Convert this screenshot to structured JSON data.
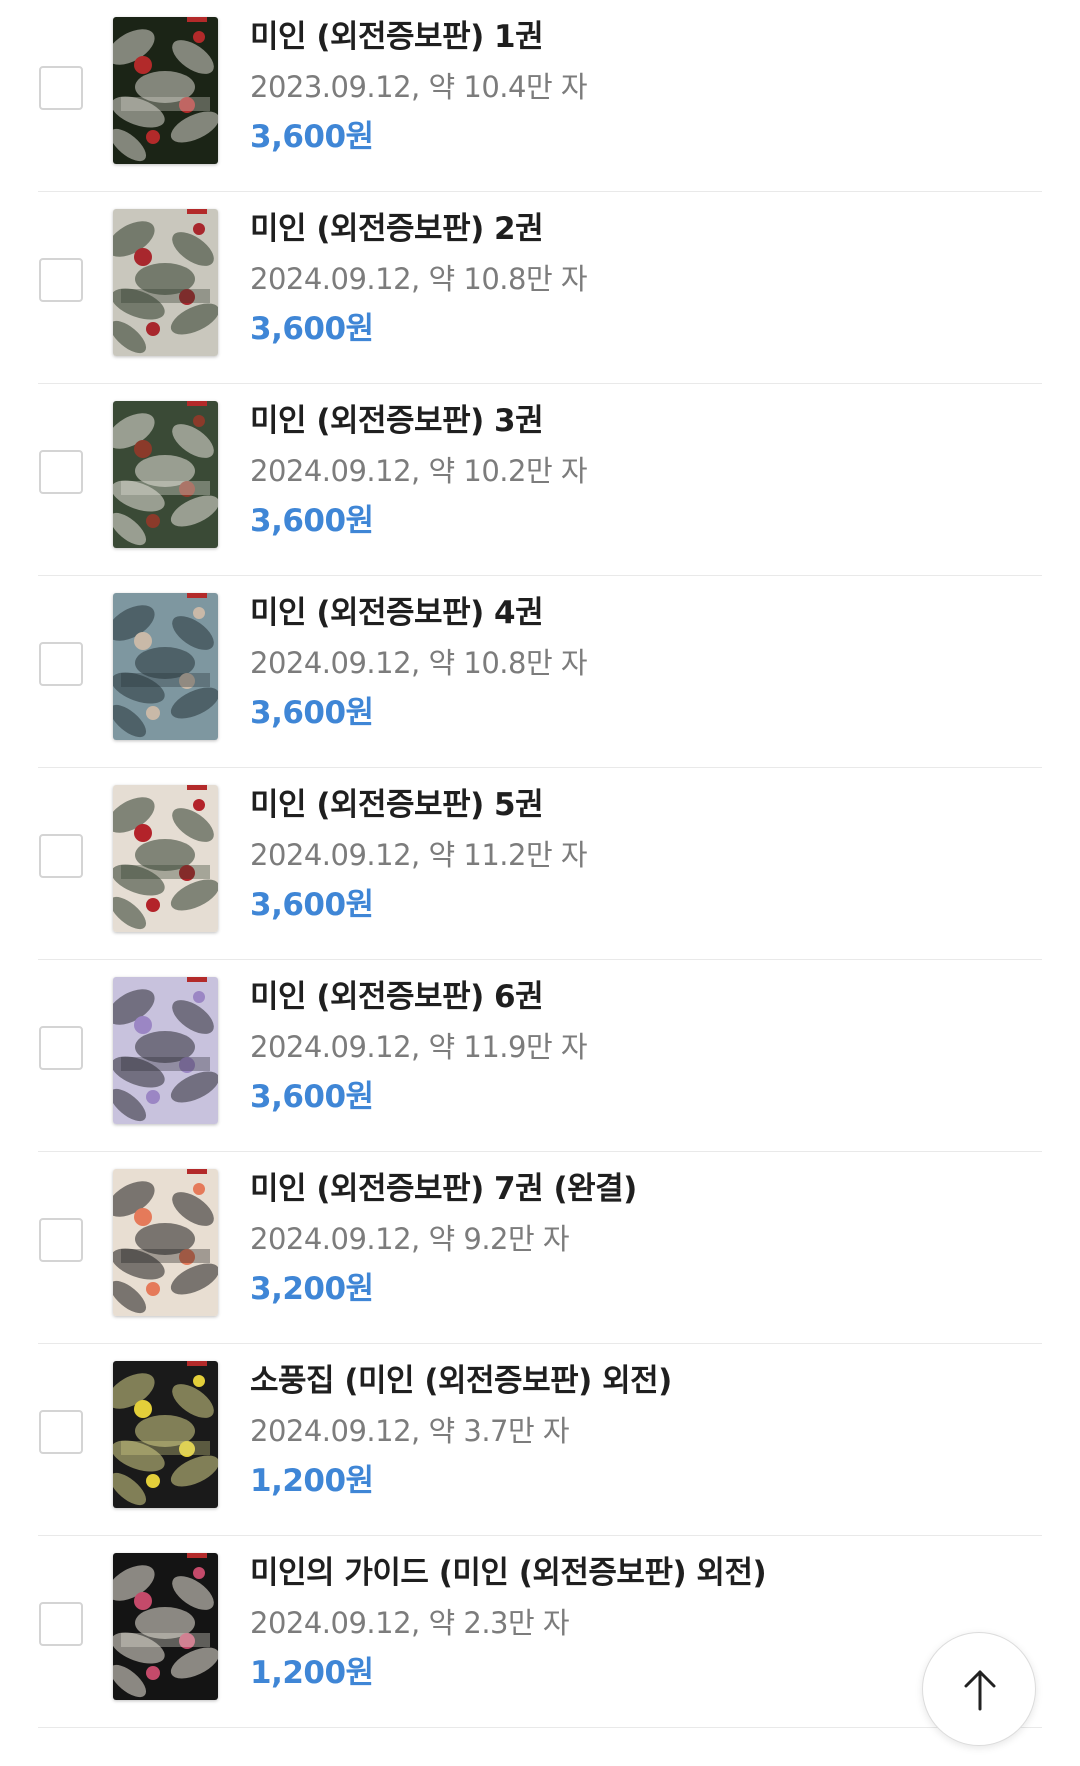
{
  "books": [
    {
      "title": "미인 (외전증보판) 1권",
      "meta": "2023.09.12, 약 10.4만 자",
      "price": "3,600원",
      "cover_bg": "#1b2416",
      "cover_accent": "#d9d7cf",
      "cover_flower": "#b22a2a"
    },
    {
      "title": "미인 (외전증보판) 2권",
      "meta": "2024.09.12, 약 10.8만 자",
      "price": "3,600원",
      "cover_bg": "#c9c7bd",
      "cover_accent": "#2d3a2a",
      "cover_flower": "#a8272d"
    },
    {
      "title": "미인 (외전증보판) 3권",
      "meta": "2024.09.12, 약 10.2만 자",
      "price": "3,600원",
      "cover_bg": "#3a4a36",
      "cover_accent": "#e7e4dc",
      "cover_flower": "#8b3a2a"
    },
    {
      "title": "미인 (외전증보판) 4권",
      "meta": "2024.09.12, 약 10.8만 자",
      "price": "3,600원",
      "cover_bg": "#7e97a0",
      "cover_accent": "#27343a",
      "cover_flower": "#c9b9a8"
    },
    {
      "title": "미인 (외전증보판) 5권",
      "meta": "2024.09.12, 약 11.2만 자",
      "price": "3,600원",
      "cover_bg": "#e5ddd3",
      "cover_accent": "#2e3b2b",
      "cover_flower": "#b3232a"
    },
    {
      "title": "미인 (외전증보판) 6권",
      "meta": "2024.09.12, 약 11.9만 자",
      "price": "3,600원",
      "cover_bg": "#c8c2dd",
      "cover_accent": "#2c2c33",
      "cover_flower": "#9b86c4"
    },
    {
      "title": "미인 (외전증보판) 7권 (완결)",
      "meta": "2024.09.12, 약 9.2만 자",
      "price": "3,200원",
      "cover_bg": "#e8ded2",
      "cover_accent": "#1e1e1e",
      "cover_flower": "#e57a5a"
    },
    {
      "title": "소풍집 (미인 (외전증보판) 외전)",
      "meta": "2024.09.12, 약 3.7만 자",
      "price": "1,200원",
      "cover_bg": "#1a1a1a",
      "cover_accent": "#d7d38a",
      "cover_flower": "#e3cf3a"
    },
    {
      "title": "미인의 가이드 (미인 (외전증보판) 외전)",
      "meta": "2024.09.12, 약 2.3만 자",
      "price": "1,200원",
      "cover_bg": "#141414",
      "cover_accent": "#ece7dc",
      "cover_flower": "#c44a6a"
    }
  ],
  "scroll_top_icon": "arrow-up-icon"
}
